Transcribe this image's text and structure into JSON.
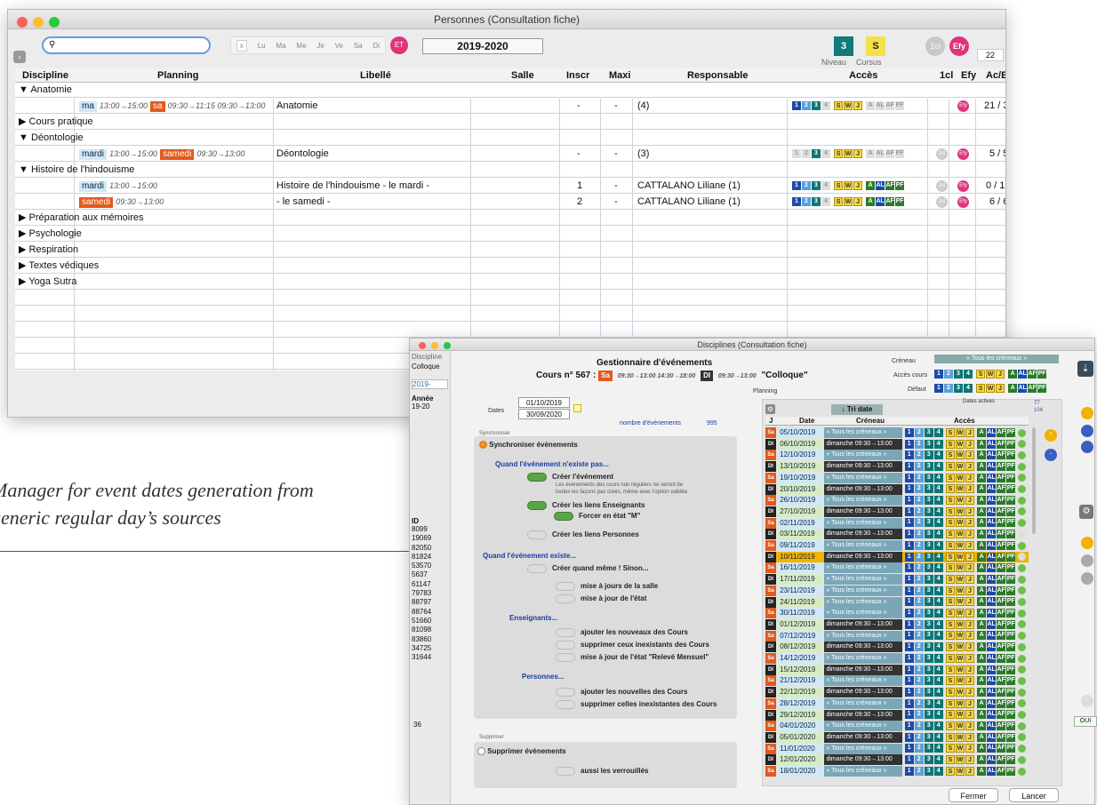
{
  "main_window": {
    "title": "Personnes (Consultation fiche)",
    "year": "2019-2020",
    "days": [
      "x",
      "Lu",
      "Ma",
      "Me",
      "Je",
      "Ve",
      "Sa",
      "Di"
    ],
    "et_badge": "ET",
    "niveau_badge": "3",
    "cursus_badge": "S",
    "niveau_label": "Niveau",
    "cursus_label": "Cursus",
    "badge_1cl": "1cl",
    "badge_efy": "Efy",
    "count": "22",
    "columns": [
      "Discipline",
      "Planning",
      "Libellé",
      "Salle",
      "Inscr",
      "Maxi",
      "Responsable",
      "Accès",
      "1cl",
      "Efy",
      "Ac/Ev"
    ],
    "rows": [
      {
        "group": "▼ Anatomie"
      },
      {
        "day": "ma",
        "time": "13:00→15:00",
        "day2": "sa",
        "time2": "09:30→11:15  09:30→13:00",
        "libelle": "Anatomie",
        "inscr": "-",
        "maxi": "-",
        "resp": "(4)",
        "acev": "21 / 33"
      },
      {
        "group": "▶ Cours pratique"
      },
      {
        "group": "▼ Déontologie"
      },
      {
        "day": "mardi",
        "time": "13:00→15:00",
        "day2": "samedi",
        "time2": "09:30→13:00",
        "libelle": "Déontologie",
        "inscr": "-",
        "maxi": "-",
        "resp": "(3)",
        "acev": "5 / 5"
      },
      {
        "group": "▼ Histoire de l'hindouisme"
      },
      {
        "day": "mardi",
        "time": "13:00→15:00",
        "day2": "",
        "time2": "",
        "libelle": "Histoire de l'hindouisme - le mardi -",
        "inscr": "1",
        "maxi": "-",
        "resp": "CATTALANO Liliane (1)",
        "acev": "0 / 12"
      },
      {
        "day": "",
        "time": "",
        "day2": "samedi",
        "time2": "09:30→13:00",
        "libelle": "- le samedi -",
        "inscr": "2",
        "maxi": "-",
        "resp": "CATTALANO Liliane (1)",
        "acev": "6 / 6"
      },
      {
        "group": "▶ Préparation aux mémoires"
      },
      {
        "group": "▶ Psychologie"
      },
      {
        "group": "▶ Respiration"
      },
      {
        "group": "▶ Textes védiques"
      },
      {
        "group": "▶ Yoga Sutra"
      }
    ]
  },
  "caption": {
    "line1": "Manager for event dates generation from",
    "line2": "generic regular day’s sources"
  },
  "dialog": {
    "title": "Disciplines (Consultation fiche)",
    "header": "Gestionnaire d'événements",
    "cours": "Cours n° 567 :",
    "cours_sa": "Sa",
    "cours_times": "09:30→13:00  14:30→18:00",
    "cours_di": "DI",
    "cours_di_time": "09:30→13:00",
    "cours_name": "\"Colloque\"",
    "left_discipline": "Discipline",
    "left_colloque": "Colloque",
    "left_year": "2019-",
    "left_annee": "Année",
    "left_1920": "19-20",
    "left_id": "ID",
    "left_ids": [
      "8099",
      "19069",
      "82050",
      "81824",
      "53570",
      "5637",
      "61147",
      "79783",
      "88797",
      "88764",
      "51660",
      "81098",
      "83860",
      "34725",
      "31644"
    ],
    "left_36": "36",
    "creneau_label": "Créneau",
    "creneau_value": "« Tous les créneaux »",
    "acces_cours": "Accès cours",
    "defaut": "Défaut",
    "planning": "Planning",
    "date_from": "01/10/2019",
    "date_to": "30/09/2020",
    "dates_label": "Dates",
    "nb_label": "nombre d'événements",
    "nb_value": "995",
    "dates_actives": "Dates actives",
    "da1": "77",
    "da2": "104",
    "tri": "↓ Tri date",
    "synchroniser": "Synchroniser",
    "sync_main": "Synchroniser évènements",
    "sec1": "Quand l'événement n'existe pas...",
    "opt1": "Créer l'événement",
    "opt1_note1": "Les événements des cours non réguliers ne seront de",
    "opt1_note2": "toutes les façons pas créés, même avec l'option validée.",
    "opt2": "Créer les liens Enseignants",
    "opt3": "Forcer en état \"M\"",
    "opt4": "Créer les liens Personnes",
    "sec2": "Quand l'événement existe...",
    "opt5": "Créer quand même ! Sinon...",
    "opt6": "mise à jours de la salle",
    "opt7": "mise à jour de l'état",
    "sec3": "Enseignants...",
    "opt8": "ajouter les nouveaux des Cours",
    "opt9": "supprimer ceux inexistants des Cours",
    "opt10": "mise à jour de l'état \"Relevé Mensuel\"",
    "sec4": "Personnes...",
    "opt11": "ajouter les nouvelles des Cours",
    "opt12": "supprimer celles inexistantes des Cours",
    "supprimer": "Supprimer",
    "sup_main": "Supprimer évènements",
    "opt13": "aussi les verrouillés",
    "col_j": "J",
    "col_date": "Date",
    "col_creneau": "Créneau",
    "col_acces": "Accès",
    "events": [
      {
        "j": "Sa",
        "date": "05/10/2019",
        "cr": "« Tous les créneaux »"
      },
      {
        "j": "DI",
        "date": "06/10/2019",
        "cr": "dimanche 09:30→13:00"
      },
      {
        "j": "Sa",
        "date": "12/10/2019",
        "cr": "« Tous les créneaux »"
      },
      {
        "j": "DI",
        "date": "13/10/2019",
        "cr": "dimanche 09:30→13:00"
      },
      {
        "j": "Sa",
        "date": "19/10/2019",
        "cr": "« Tous les créneaux »"
      },
      {
        "j": "DI",
        "date": "20/10/2019",
        "cr": "dimanche 09:30→13:00"
      },
      {
        "j": "Sa",
        "date": "26/10/2019",
        "cr": "« Tous les créneaux »"
      },
      {
        "j": "DI",
        "date": "27/10/2019",
        "cr": "dimanche 09:30→13:00"
      },
      {
        "j": "Sa",
        "date": "02/11/2019",
        "cr": "« Tous les créneaux »"
      },
      {
        "j": "DI",
        "date": "03/11/2019",
        "cr": "dimanche 09:30→13:00"
      },
      {
        "j": "Sa",
        "date": "09/11/2019",
        "cr": "« Tous les créneaux »"
      },
      {
        "j": "DI",
        "date": "10/11/2019",
        "cr": "dimanche 09:30→13:00"
      },
      {
        "j": "Sa",
        "date": "16/11/2019",
        "cr": "« Tous les créneaux »"
      },
      {
        "j": "DI",
        "date": "17/11/2019",
        "cr": "« Tous les créneaux »"
      },
      {
        "j": "Sa",
        "date": "23/11/2019",
        "cr": "« Tous les créneaux »"
      },
      {
        "j": "DI",
        "date": "24/11/2019",
        "cr": "« Tous les créneaux »"
      },
      {
        "j": "Sa",
        "date": "30/11/2019",
        "cr": "« Tous les créneaux »"
      },
      {
        "j": "DI",
        "date": "01/12/2019",
        "cr": "dimanche 09:30→13:00"
      },
      {
        "j": "Sa",
        "date": "07/12/2019",
        "cr": "« Tous les créneaux »"
      },
      {
        "j": "DI",
        "date": "08/12/2019",
        "cr": "dimanche 09:30→13:00"
      },
      {
        "j": "Sa",
        "date": "14/12/2019",
        "cr": "« Tous les créneaux »"
      },
      {
        "j": "DI",
        "date": "15/12/2019",
        "cr": "dimanche 09:30→13:00"
      },
      {
        "j": "Sa",
        "date": "21/12/2019",
        "cr": "« Tous les créneaux »"
      },
      {
        "j": "DI",
        "date": "22/12/2019",
        "cr": "dimanche 09:30→13:00"
      },
      {
        "j": "Sa",
        "date": "28/12/2019",
        "cr": "« Tous les créneaux »"
      },
      {
        "j": "DI",
        "date": "29/12/2019",
        "cr": "dimanche 09:30→13:00"
      },
      {
        "j": "Sa",
        "date": "04/01/2020",
        "cr": "« Tous les créneaux »"
      },
      {
        "j": "DI",
        "date": "05/01/2020",
        "cr": "dimanche 09:30→13:00"
      },
      {
        "j": "Sa",
        "date": "11/01/2020",
        "cr": "« Tous les créneaux »"
      },
      {
        "j": "DI",
        "date": "12/01/2020",
        "cr": "dimanche 09:30→13:00"
      },
      {
        "j": "Sa",
        "date": "18/01/2020",
        "cr": "« Tous les créneaux »"
      }
    ],
    "selected_index": 11,
    "fermer": "Fermer",
    "lancer": "Lancer",
    "oui": "OUI"
  }
}
